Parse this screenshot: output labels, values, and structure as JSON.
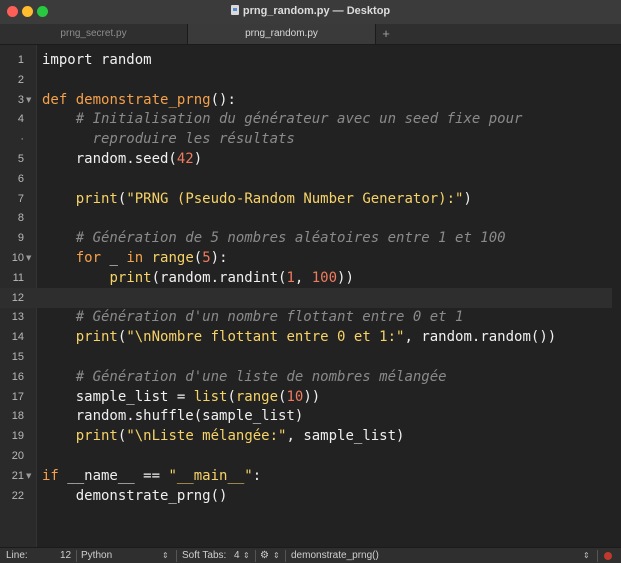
{
  "window": {
    "title": "prng_random.py — Desktop"
  },
  "tabs": [
    {
      "label": "prng_secret.py",
      "active": false
    },
    {
      "label": "prng_random.py",
      "active": true
    }
  ],
  "tab_add": "+",
  "editor": {
    "lines": [
      {
        "n": "1",
        "fold": ""
      },
      {
        "n": "2",
        "fold": ""
      },
      {
        "n": "3",
        "fold": "▼"
      },
      {
        "n": "4",
        "fold": ""
      },
      {
        "n": "·",
        "fold": ""
      },
      {
        "n": "5",
        "fold": ""
      },
      {
        "n": "6",
        "fold": ""
      },
      {
        "n": "7",
        "fold": ""
      },
      {
        "n": "8",
        "fold": ""
      },
      {
        "n": "9",
        "fold": ""
      },
      {
        "n": "10",
        "fold": "▼"
      },
      {
        "n": "11",
        "fold": ""
      },
      {
        "n": "12",
        "fold": ""
      },
      {
        "n": "13",
        "fold": ""
      },
      {
        "n": "14",
        "fold": ""
      },
      {
        "n": "15",
        "fold": ""
      },
      {
        "n": "16",
        "fold": ""
      },
      {
        "n": "17",
        "fold": ""
      },
      {
        "n": "18",
        "fold": ""
      },
      {
        "n": "19",
        "fold": ""
      },
      {
        "n": "20",
        "fold": ""
      },
      {
        "n": "21",
        "fold": "▼"
      },
      {
        "n": "22",
        "fold": ""
      }
    ],
    "code": [
      [
        [
          "t",
          "import"
        ],
        [
          "t",
          " random"
        ]
      ],
      [],
      [
        [
          "k",
          "def"
        ],
        [
          "t",
          " "
        ],
        [
          "f",
          "demonstrate_prng"
        ],
        [
          "t",
          "():"
        ]
      ],
      [
        [
          "t",
          "    "
        ],
        [
          "c",
          "# Initialisation du générateur avec un seed fixe pour"
        ]
      ],
      [
        [
          "t",
          "    "
        ],
        [
          "c",
          "  reproduire les résultats"
        ]
      ],
      [
        [
          "t",
          "    random.seed("
        ],
        [
          "n",
          "42"
        ],
        [
          "t",
          ")"
        ]
      ],
      [],
      [
        [
          "t",
          "    "
        ],
        [
          "b",
          "print"
        ],
        [
          "t",
          "("
        ],
        [
          "s",
          "\"PRNG (Pseudo-Random Number Generator):\""
        ],
        [
          "t",
          ")"
        ]
      ],
      [],
      [
        [
          "t",
          "    "
        ],
        [
          "c",
          "# Génération de 5 nombres aléatoires entre 1 et 100"
        ]
      ],
      [
        [
          "t",
          "    "
        ],
        [
          "k",
          "for"
        ],
        [
          "t",
          " _ "
        ],
        [
          "k",
          "in"
        ],
        [
          "t",
          " "
        ],
        [
          "b",
          "range"
        ],
        [
          "t",
          "("
        ],
        [
          "n",
          "5"
        ],
        [
          "t",
          "):"
        ]
      ],
      [
        [
          "t",
          "        "
        ],
        [
          "b",
          "print"
        ],
        [
          "t",
          "(random.randint("
        ],
        [
          "n",
          "1"
        ],
        [
          "t",
          ", "
        ],
        [
          "n",
          "100"
        ],
        [
          "t",
          "))"
        ]
      ],
      [],
      [
        [
          "t",
          "    "
        ],
        [
          "c",
          "# Génération d'un nombre flottant entre 0 et 1"
        ]
      ],
      [
        [
          "t",
          "    "
        ],
        [
          "b",
          "print"
        ],
        [
          "t",
          "("
        ],
        [
          "s",
          "\"\\nNombre flottant entre 0 et 1:\""
        ],
        [
          "t",
          ", random.random())"
        ]
      ],
      [],
      [
        [
          "t",
          "    "
        ],
        [
          "c",
          "# Génération d'une liste de nombres mélangée"
        ]
      ],
      [
        [
          "t",
          "    sample_list = "
        ],
        [
          "b",
          "list"
        ],
        [
          "t",
          "("
        ],
        [
          "b",
          "range"
        ],
        [
          "t",
          "("
        ],
        [
          "n",
          "10"
        ],
        [
          "t",
          "))"
        ]
      ],
      [
        [
          "t",
          "    random.shuffle(sample_list)"
        ]
      ],
      [
        [
          "t",
          "    "
        ],
        [
          "b",
          "print"
        ],
        [
          "t",
          "("
        ],
        [
          "s",
          "\"\\nListe mélangée:\""
        ],
        [
          "t",
          ", sample_list)"
        ]
      ],
      [],
      [
        [
          "k",
          "if"
        ],
        [
          "t",
          " __name__ == "
        ],
        [
          "s",
          "\"__main__\""
        ],
        [
          "t",
          ":"
        ]
      ],
      [
        [
          "t",
          "    demonstrate_prng()"
        ]
      ]
    ]
  },
  "status": {
    "line_label": "Line:",
    "line_value": "12",
    "language": "Python",
    "tabs_label": "Soft Tabs:",
    "tabs_value": "4",
    "symbol": "demonstrate_prng()"
  },
  "colors": {
    "keyword": "#f6a14a",
    "builtin": "#f7d367",
    "string": "#f7d367",
    "number": "#f07b5e",
    "comment": "#8a8a8a",
    "text": "#f0f0f0",
    "record": "#c0392b"
  }
}
